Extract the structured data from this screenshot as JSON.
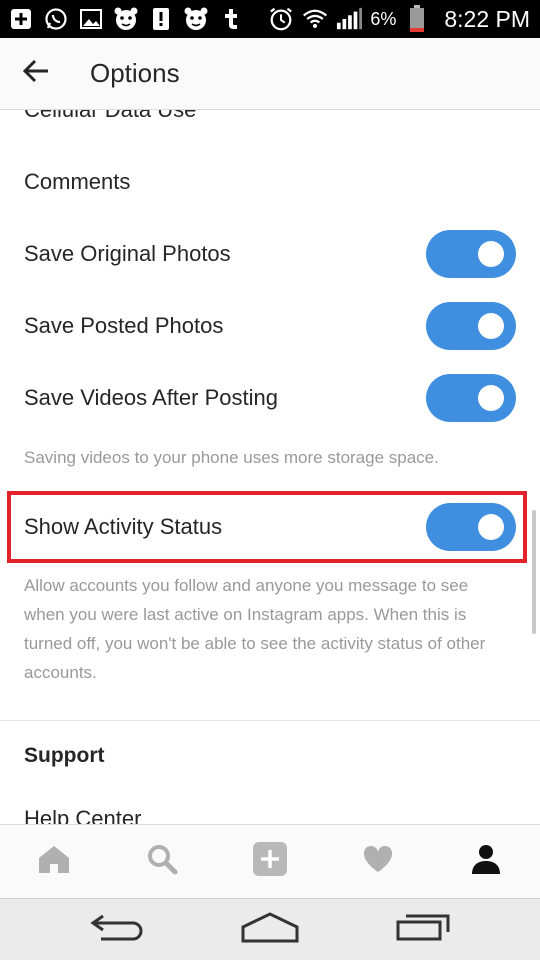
{
  "status_bar": {
    "battery_percent": "6%",
    "time": "8:22 PM",
    "icons": [
      "plus-box-icon",
      "whatsapp-icon",
      "image-icon",
      "tiger-icon",
      "alert-icon",
      "tiger-icon",
      "tumblr-icon",
      "alarm-icon",
      "wifi-icon",
      "signal-icon",
      "battery-icon"
    ]
  },
  "header": {
    "title": "Options",
    "back_icon": "arrow-left-icon"
  },
  "list": {
    "partial_top": "Cellular Data Use",
    "items": [
      {
        "label": "Comments"
      },
      {
        "label": "Save Original Photos",
        "toggle": true
      },
      {
        "label": "Save Posted Photos",
        "toggle": true
      },
      {
        "label": "Save Videos After Posting",
        "toggle": true
      }
    ],
    "videos_note": "Saving videos to your phone uses more storage space.",
    "activity": {
      "label": "Show Activity Status",
      "toggle": true,
      "note_lines": [
        "Allow accounts you follow and anyone you message to see",
        "when you were last active on Instagram apps. When this is",
        "turned off, you won't be able to see the activity status of other",
        "accounts."
      ]
    },
    "support_heading": "Support",
    "partial_bottom": "Help Center"
  },
  "tab_bar": {
    "icons": [
      "home-icon",
      "search-icon",
      "add-post-icon",
      "heart-icon",
      "profile-icon"
    ]
  },
  "nav_bar": {
    "icons": [
      "back-nav-icon",
      "home-nav-icon",
      "recents-nav-icon"
    ]
  },
  "colors": {
    "toggle_on": "#3f8ee0",
    "highlight": "#e3222b",
    "text": "#262626",
    "secondary_text": "#999999"
  }
}
